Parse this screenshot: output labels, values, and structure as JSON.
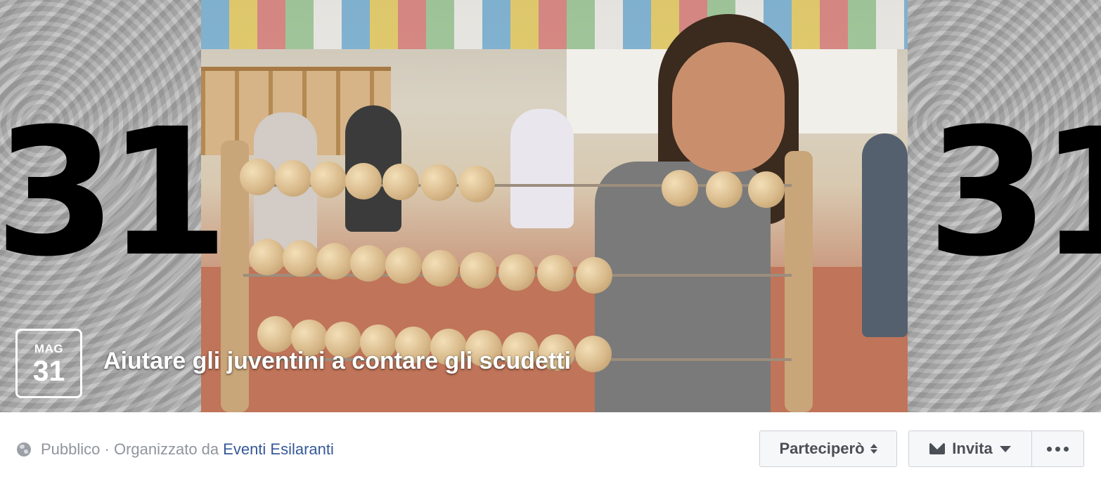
{
  "cover": {
    "left_number": "31",
    "right_number": "31"
  },
  "event": {
    "date_month": "MAG",
    "date_day": "31",
    "title": "Aiutare gli juventini a contare gli scudetti"
  },
  "meta": {
    "privacy": "Pubblico",
    "separator": " · ",
    "organized_by": "Organizzato da",
    "organizer": "Eventi Esilaranti"
  },
  "actions": {
    "going_label": "Parteciperò",
    "invite_label": "Invita"
  },
  "colors": {
    "link": "#365899",
    "meta_text": "#90949c",
    "button_text": "#4b4f56",
    "button_bg": "#f6f7f9"
  },
  "icons": [
    "globe-icon",
    "updown-icon",
    "mail-icon",
    "caret-down-icon",
    "more-dots-icon"
  ]
}
